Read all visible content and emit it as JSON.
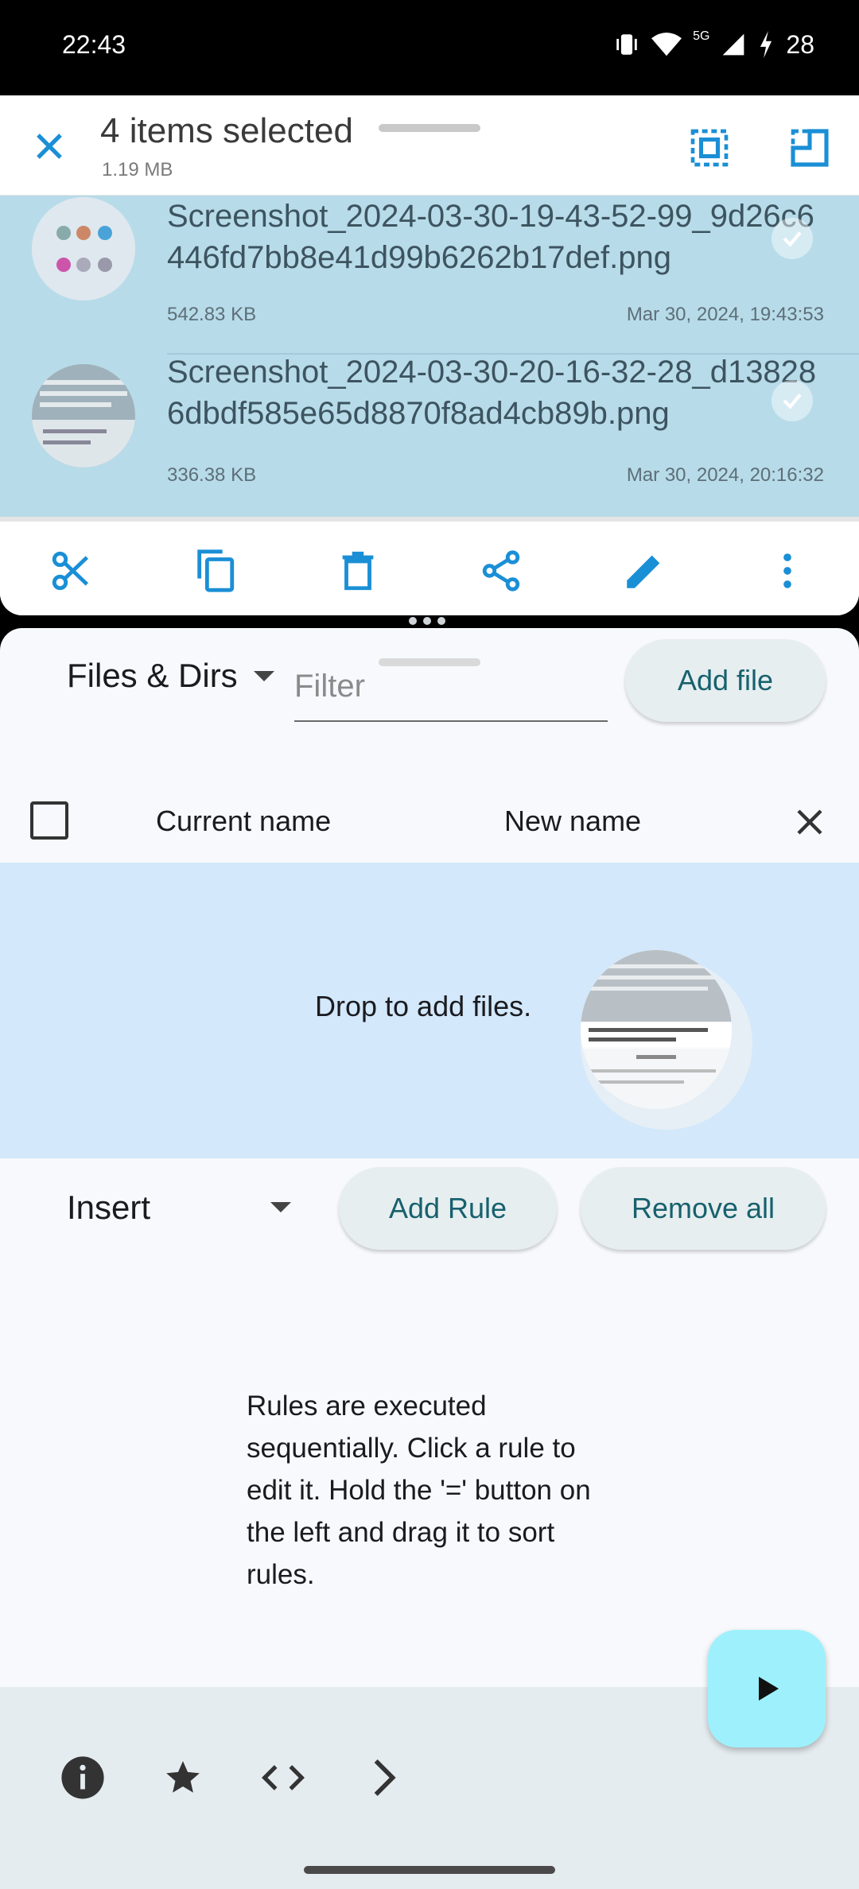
{
  "status": {
    "time": "22:43",
    "battery": "28",
    "network": "5G"
  },
  "selection": {
    "title": "4 items selected",
    "total_size": "1.19 MB"
  },
  "files": [
    {
      "name": "Screenshot_2024-03-30-19-43-52-99_9d26c6446fd7bb8e41d99b6262b17def.png",
      "size": "542.83 KB",
      "date": "Mar 30, 2024, 19:43:53"
    },
    {
      "name": "Screenshot_2024-03-30-20-16-32-28_d138286dbdf585e65d8870f8ad4cb89b.png",
      "size": "336.38 KB",
      "date": "Mar 30, 2024, 20:16:32"
    }
  ],
  "app": {
    "files_dropdown": "Files & Dirs",
    "filter_placeholder": "Filter",
    "add_file": "Add file",
    "col_current": "Current name",
    "col_new": "New name",
    "drop_text": "Drop to add files.",
    "rule_type": "Insert",
    "add_rule": "Add Rule",
    "remove_all": "Remove all",
    "info_text": "Rules are executed sequentially. Click a rule to edit it. Hold the '=' button on the left and drag it to sort rules."
  },
  "icons": {
    "accent": "#1a8fd6",
    "toolbar": [
      "cut-icon",
      "copy-icon",
      "delete-icon",
      "share-icon",
      "rename-icon",
      "more-icon"
    ],
    "bottom": [
      "info-icon",
      "star-icon",
      "code-icon",
      "chevron-right-icon"
    ]
  }
}
